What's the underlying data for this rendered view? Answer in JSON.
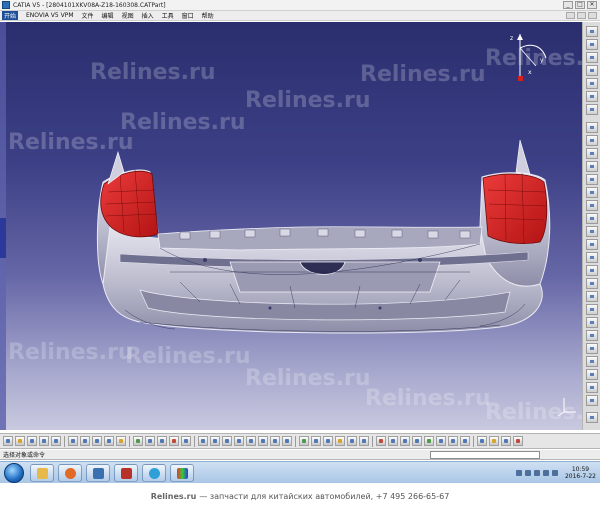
{
  "window": {
    "title": "CATIA V5 - [2804101XKV08A-Z18-160308.CATPart]",
    "buttons": [
      "_",
      "□",
      "✕"
    ]
  },
  "menu": {
    "logo": "开始",
    "items": [
      "ENOVIA V5 VPM",
      "文件",
      "编辑",
      "视图",
      "插入",
      "工具",
      "窗口",
      "帮助"
    ]
  },
  "watermark": "Relines.ru",
  "status": {
    "prompt": "选择对象或命令"
  },
  "taskbar": {
    "apps": [
      "folder",
      "media-player",
      "catia",
      "catia-part",
      "browser",
      "paint"
    ],
    "time": "10:59",
    "date": "2016-7-22"
  },
  "footer": {
    "brand": "Relines.ru",
    "text": "— запчасти для китайских автомобилей, +7 495 266-65-67"
  },
  "compass": {
    "axes": [
      "z",
      "y",
      "x"
    ]
  },
  "colors": {
    "background_top": "#2a2e6e",
    "background_bottom": "#c9c9e0",
    "tail_light": "#d21f1f",
    "bumper": "#c8c8d4"
  }
}
